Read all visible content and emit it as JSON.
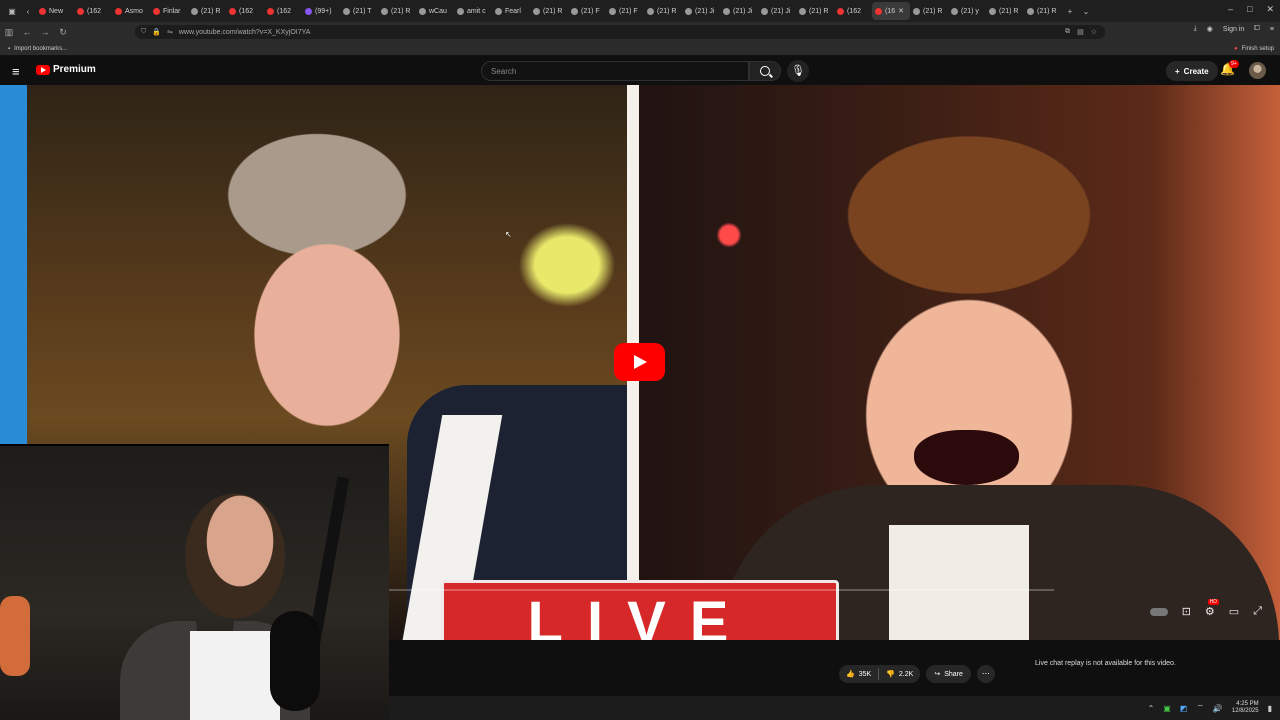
{
  "browser": {
    "tabs": [
      {
        "label": "New",
        "color": "#e33"
      },
      {
        "label": "(162",
        "color": "#e33"
      },
      {
        "label": "Asmo",
        "color": "#e33"
      },
      {
        "label": "Finlar",
        "color": "#e33"
      },
      {
        "label": "(21) R",
        "color": "#999"
      },
      {
        "label": "(162",
        "color": "#e33"
      },
      {
        "label": "(162",
        "color": "#e33"
      },
      {
        "label": "(99+)",
        "color": "#8855ee"
      },
      {
        "label": "(21) T",
        "color": "#999"
      },
      {
        "label": "(21) R",
        "color": "#999"
      },
      {
        "label": "wCau",
        "color": "#999"
      },
      {
        "label": "amit c",
        "color": "#999"
      },
      {
        "label": "Fearl",
        "color": "#999"
      },
      {
        "label": "(21) R",
        "color": "#999"
      },
      {
        "label": "(21) F",
        "color": "#999"
      },
      {
        "label": "(21) F",
        "color": "#999"
      },
      {
        "label": "(21) R",
        "color": "#999"
      },
      {
        "label": "(21) Ji",
        "color": "#999"
      },
      {
        "label": "(21) Ji",
        "color": "#999"
      },
      {
        "label": "(21) Ji",
        "color": "#999"
      },
      {
        "label": "(21) R",
        "color": "#999"
      },
      {
        "label": "(162",
        "color": "#e33"
      },
      {
        "label": "(16",
        "color": "#e33",
        "active": true
      },
      {
        "label": "(21) R",
        "color": "#999"
      },
      {
        "label": "(21) y",
        "color": "#999"
      },
      {
        "label": "(21) R",
        "color": "#999"
      },
      {
        "label": "(21) R",
        "color": "#999"
      }
    ],
    "url": "www.youtube.com/watch?v=X_KXyjOI7YA",
    "sign_in": "Sign in",
    "bookmark_import": "Import bookmarks...",
    "finish_setup": "Finish setup"
  },
  "youtube": {
    "logo_text": "Premium",
    "search_placeholder": "Search",
    "create_label": "Create",
    "notif_count": "9+",
    "live_text": "LIVE",
    "likes": "35K",
    "dislikes": "2.2K",
    "share_label": "Share",
    "chat_note": "Live chat replay is not available for this video.",
    "hd_badge": "HD"
  },
  "taskbar": {
    "time": "4:25 PM",
    "date": "12/8/2025"
  },
  "colors": {
    "accent": "#ff0000",
    "background": "#0f0f0f"
  }
}
